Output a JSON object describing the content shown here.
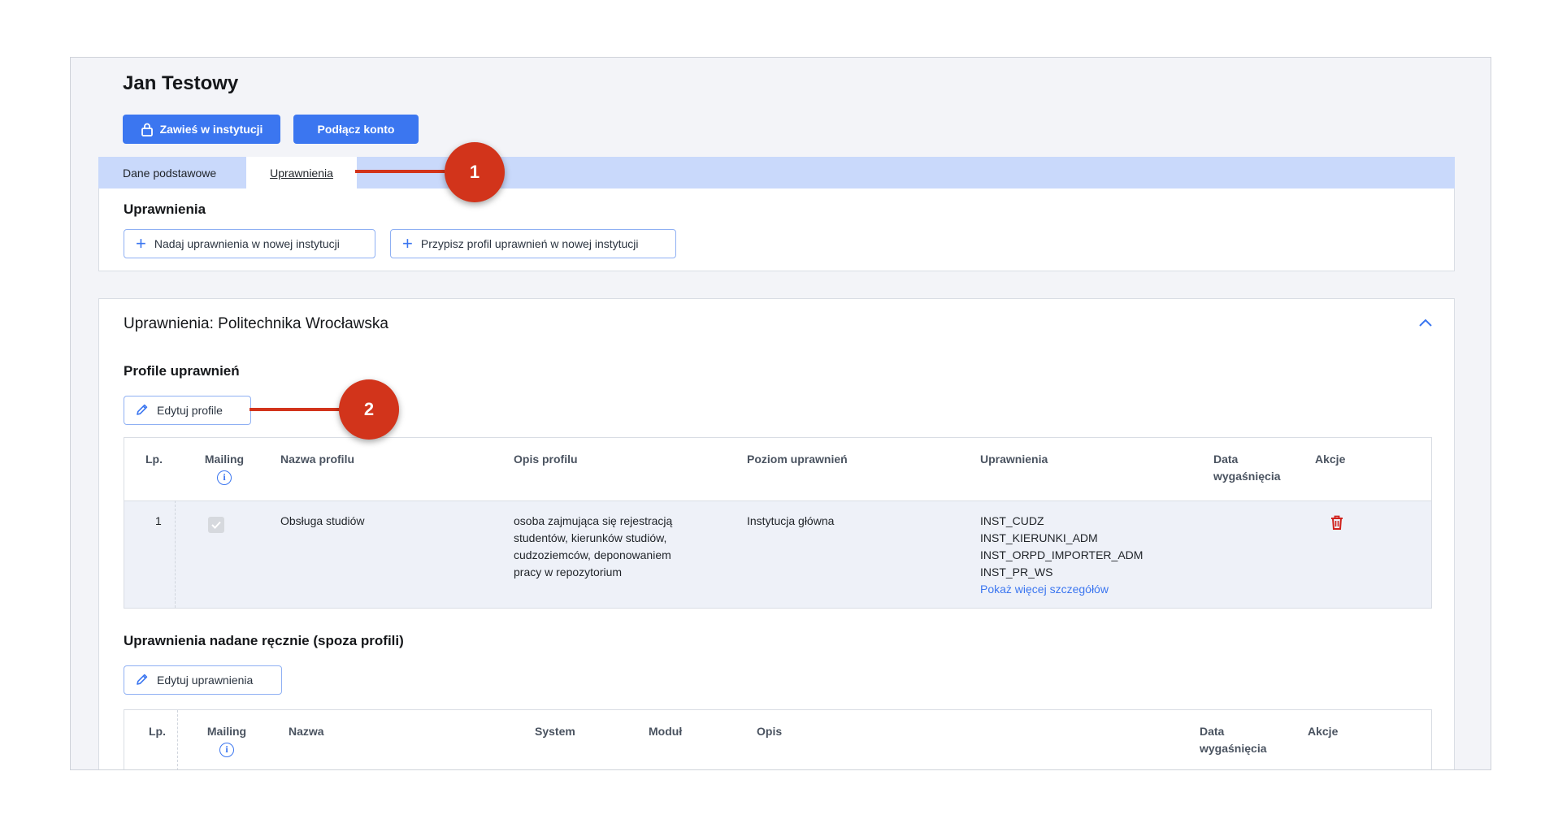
{
  "user": {
    "name": "Jan Testowy"
  },
  "actions": {
    "suspend_label": "Zawieś w instytucji",
    "connect_label": "Podłącz konto"
  },
  "tabs": [
    {
      "label": "Dane podstawowe",
      "active": false
    },
    {
      "label": "Uprawnienia",
      "active": true
    }
  ],
  "permissions": {
    "title": "Uprawnienia",
    "grant_new_label": "Nadaj uprawnienia w nowej instytucji",
    "assign_profile_label": "Przypisz profil uprawnień w nowej instytucji"
  },
  "institution": {
    "title": "Uprawnienia: Politechnika Wrocławska",
    "profiles_title": "Profile uprawnień",
    "edit_profiles_label": "Edytuj profile",
    "profiles_table": {
      "columns": [
        "Lp.",
        "Mailing",
        "Nazwa profilu",
        "Opis profilu",
        "Poziom uprawnień",
        "Uprawnienia",
        "Data wygaśnięcia",
        "Akcje"
      ],
      "rows": [
        {
          "lp": "1",
          "mailing_checked": true,
          "name": "Obsługa studiów",
          "description": "osoba zajmująca się rejestracją studentów, kierunków studiów, cudzoziemców, deponowaniem pracy w repozytorium",
          "level": "Instytucja główna",
          "permissions": [
            "INST_CUDZ",
            "INST_KIERUNKI_ADM",
            "INST_ORPD_IMPORTER_ADM",
            "INST_PR_WS"
          ],
          "more_link": "Pokaż więcej szczegółów",
          "expires": ""
        }
      ]
    },
    "manual_title": "Uprawnienia nadane ręcznie (spoza profili)",
    "edit_permissions_label": "Edytuj uprawnienia",
    "manual_table": {
      "columns": [
        "Lp.",
        "Mailing",
        "Nazwa",
        "System",
        "Moduł",
        "Opis",
        "Data wygaśnięcia",
        "Akcje"
      ]
    }
  },
  "annotations": {
    "marker1": "1",
    "marker2": "2"
  },
  "colors": {
    "primary": "#3b76f0",
    "tab_bar": "#c9d9fb",
    "marker": "#d2341b",
    "delete": "#d0211c"
  }
}
